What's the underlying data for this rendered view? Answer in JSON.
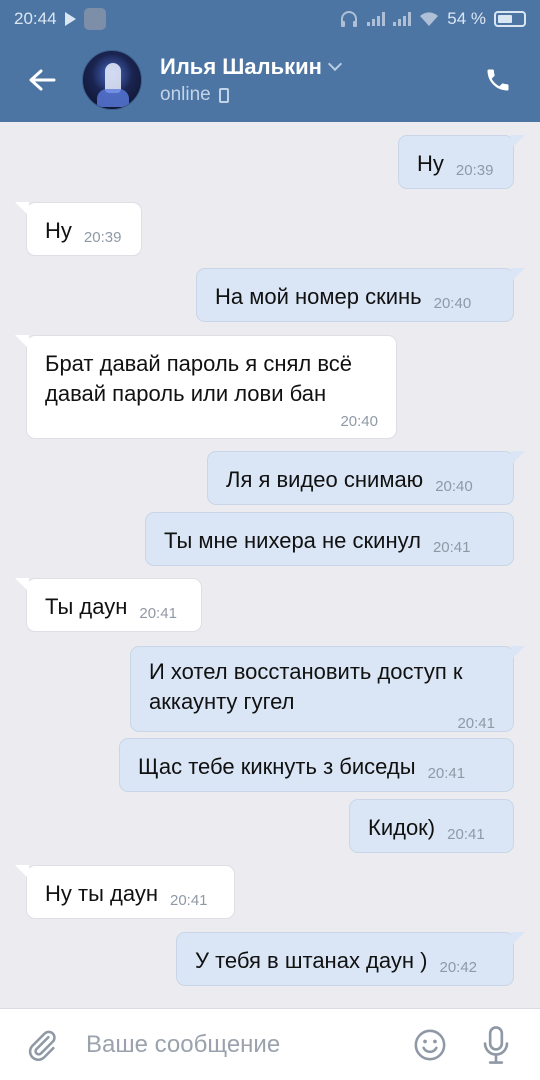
{
  "status_bar": {
    "time": "20:44",
    "battery": "54 %"
  },
  "header": {
    "contact_name": "Илья Шалькин",
    "presence": "online"
  },
  "messages": [
    {
      "dir": "out",
      "text": "Ну",
      "time": "20:39"
    },
    {
      "dir": "in",
      "text": "Ну",
      "time": "20:39"
    },
    {
      "dir": "out",
      "text": "На мой номер скинь",
      "time": "20:40"
    },
    {
      "dir": "in",
      "text": "Брат давай пароль я снял всё давай пароль или лови бан",
      "time": "20:40"
    },
    {
      "dir": "out",
      "text": "Ля я видео снимаю",
      "time": "20:40"
    },
    {
      "dir": "out",
      "text": "Ты мне нихера не скинул",
      "time": "20:41"
    },
    {
      "dir": "in",
      "text": "Ты даун",
      "time": "20:41"
    },
    {
      "dir": "out",
      "text": "И хотел восстановить доступ к аккаунту гугел",
      "time": "20:41"
    },
    {
      "dir": "out",
      "text": "Щас тебе кикнуть з биседы",
      "time": "20:41"
    },
    {
      "dir": "out",
      "text": "Кидок)",
      "time": "20:41"
    },
    {
      "dir": "in",
      "text": "Ну ты даун",
      "time": "20:41"
    },
    {
      "dir": "out",
      "text": "У тебя в штанах даун )",
      "time": "20:42"
    }
  ],
  "composer": {
    "placeholder": "Ваше сообщение"
  },
  "icons": {
    "back": "arrow-left-icon",
    "call": "phone-icon",
    "attach": "paperclip-icon",
    "emoji": "smiley-icon",
    "voice": "microphone-icon"
  },
  "colors": {
    "header": "#4c75a3",
    "outgoing_bubble": "#dae6f5",
    "incoming_bubble": "#ffffff",
    "background": "#ececf0"
  }
}
